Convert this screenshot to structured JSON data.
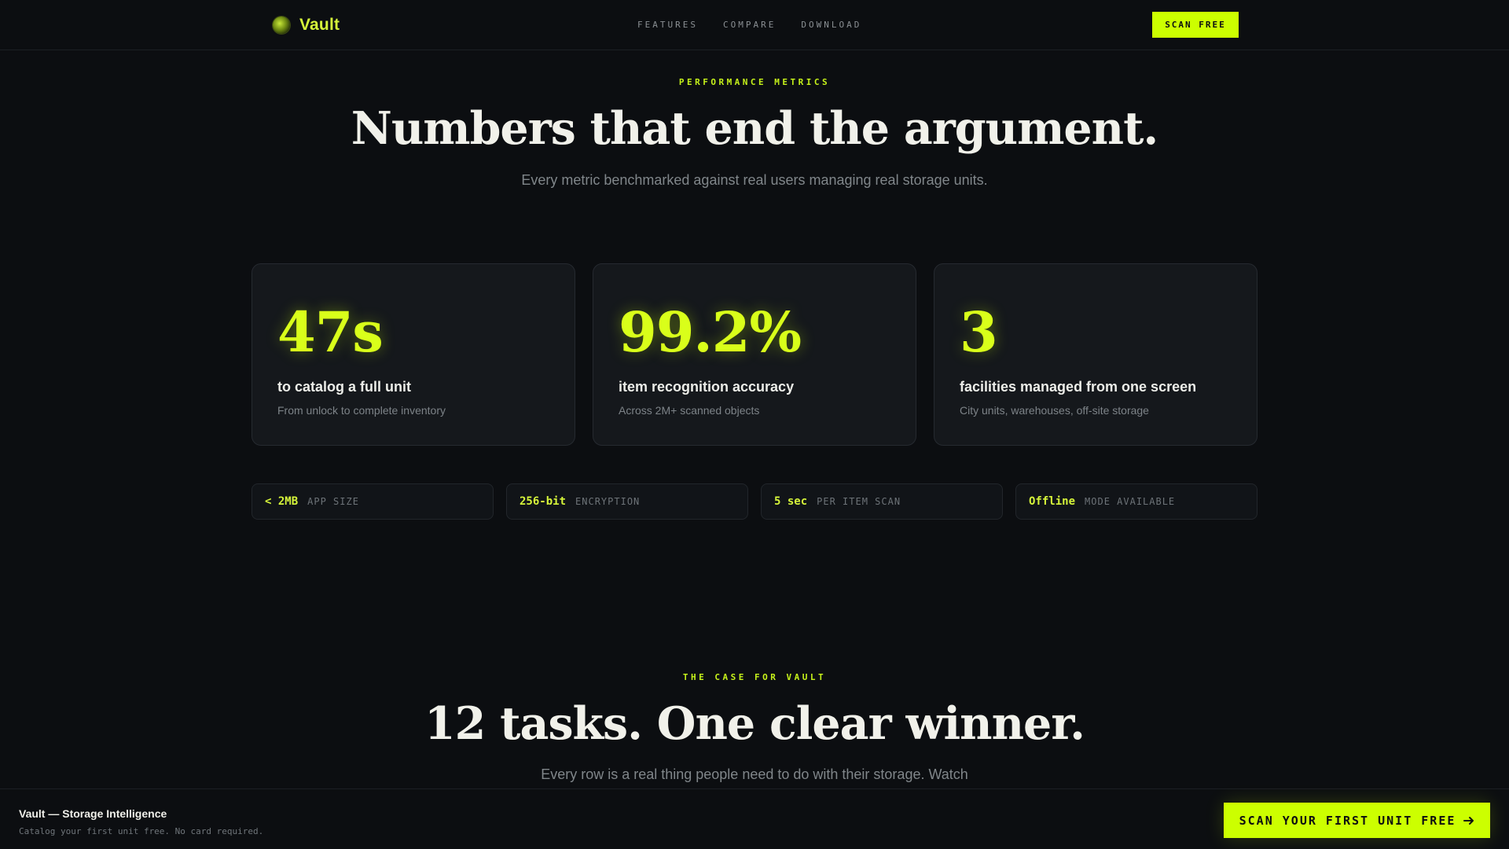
{
  "nav": {
    "brand": "Vault",
    "links": [
      "FEATURES",
      "COMPARE",
      "DOWNLOAD"
    ],
    "cta": "SCAN FREE"
  },
  "metrics_section": {
    "eyebrow": "PERFORMANCE METRICS",
    "headline": "Numbers that end the argument.",
    "subtitle": "Every metric benchmarked against real users managing real storage units.",
    "cards": [
      {
        "value": "47s",
        "label": "to catalog a full unit",
        "sub": "From unlock to complete inventory"
      },
      {
        "value": "99.2%",
        "label": "item recognition accuracy",
        "sub": "Across 2M+ scanned objects"
      },
      {
        "value": "3",
        "label": "facilities managed from one screen",
        "sub": "City units, warehouses, off-site storage"
      }
    ],
    "chips": [
      {
        "value": "< 2MB",
        "label": "APP SIZE"
      },
      {
        "value": "256-bit",
        "label": "ENCRYPTION"
      },
      {
        "value": "5 sec",
        "label": "PER ITEM SCAN"
      },
      {
        "value": "Offline",
        "label": "MODE AVAILABLE"
      }
    ]
  },
  "case_section": {
    "eyebrow": "THE CASE FOR VAULT",
    "headline": "12 tasks. One clear winner.",
    "subtitle": "Every row is a real thing people need to do with their storage. Watch"
  },
  "footer_bar": {
    "title": "Vault — Storage Intelligence",
    "sub": "Catalog your first unit free. No card required.",
    "cta": "SCAN YOUR FIRST UNIT FREE"
  },
  "colors": {
    "background": "#0c0e11",
    "accent": "#ccff00",
    "card": "#15181c"
  }
}
